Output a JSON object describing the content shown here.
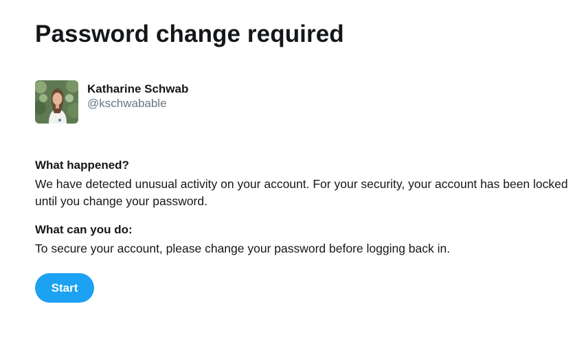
{
  "page": {
    "title": "Password change required"
  },
  "account": {
    "name": "Katharine Schwab",
    "handle": "@kschwabable"
  },
  "sections": [
    {
      "heading": "What happened?",
      "body": "We have detected unusual activity on your account. For your security, your account has been locked until you change your password."
    },
    {
      "heading": "What can you do:",
      "body": "To secure your account, please change your password before logging back in."
    }
  ],
  "actions": {
    "start_label": "Start"
  },
  "colors": {
    "primary_button": "#1da1f2",
    "text": "#14171a",
    "handle": "#657786"
  }
}
